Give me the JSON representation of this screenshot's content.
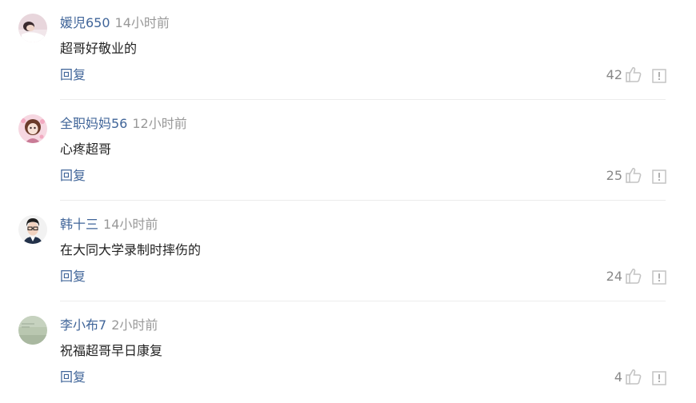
{
  "comments": [
    {
      "username": "媛児650",
      "time": "14小时前",
      "text": "超哥好敬业的",
      "reply_label": "回复",
      "likes": "42",
      "avatar": "avatar-girl-lying"
    },
    {
      "username": "全职妈妈56",
      "time": "12小时前",
      "text": "心疼超哥",
      "reply_label": "回复",
      "likes": "25",
      "avatar": "avatar-anime-girl-pink"
    },
    {
      "username": "韩十三",
      "time": "14小时前",
      "text": "在大同大学录制时摔伤的",
      "reply_label": "回复",
      "likes": "24",
      "avatar": "avatar-man-glasses"
    },
    {
      "username": "李小布7",
      "time": "2小时前",
      "text": "祝福超哥早日康复",
      "reply_label": "回复",
      "likes": "4",
      "avatar": "avatar-green-gray"
    }
  ],
  "icons": {
    "like": "thumbs-up-icon",
    "report": "report-icon"
  },
  "colors": {
    "username": "#406599",
    "time": "#999999",
    "text": "#222222",
    "icon": "#c4c4c4"
  }
}
